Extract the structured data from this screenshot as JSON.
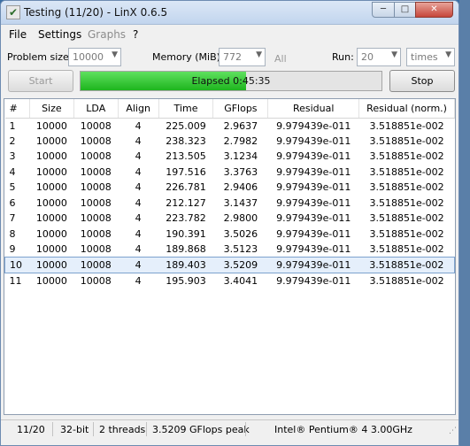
{
  "window": {
    "title": "Testing (11/20) - LinX 0.6.5",
    "minimize": "─",
    "maximize": "□",
    "close": "✕"
  },
  "menu": [
    "File",
    "Settings",
    "Graphs",
    "?"
  ],
  "controls": {
    "problem_size_label": "Problem size:",
    "problem_size_value": "10000",
    "memory_label": "Memory (MiB):",
    "memory_value": "772",
    "all_label": "All",
    "run_label": "Run:",
    "run_value": "20",
    "run_unit": "times",
    "start_label": "Start",
    "stop_label": "Stop"
  },
  "progress": {
    "text": "Elapsed 0:45:35",
    "fraction": 0.55
  },
  "table": {
    "columns": [
      "#",
      "Size",
      "LDA",
      "Align",
      "Time",
      "GFlops",
      "Residual",
      "Residual (norm.)"
    ],
    "rows": [
      [
        "1",
        "10000",
        "10008",
        "4",
        "225.009",
        "2.9637",
        "9.979439e-011",
        "3.518851e-002"
      ],
      [
        "2",
        "10000",
        "10008",
        "4",
        "238.323",
        "2.7982",
        "9.979439e-011",
        "3.518851e-002"
      ],
      [
        "3",
        "10000",
        "10008",
        "4",
        "213.505",
        "3.1234",
        "9.979439e-011",
        "3.518851e-002"
      ],
      [
        "4",
        "10000",
        "10008",
        "4",
        "197.516",
        "3.3763",
        "9.979439e-011",
        "3.518851e-002"
      ],
      [
        "5",
        "10000",
        "10008",
        "4",
        "226.781",
        "2.9406",
        "9.979439e-011",
        "3.518851e-002"
      ],
      [
        "6",
        "10000",
        "10008",
        "4",
        "212.127",
        "3.1437",
        "9.979439e-011",
        "3.518851e-002"
      ],
      [
        "7",
        "10000",
        "10008",
        "4",
        "223.782",
        "2.9800",
        "9.979439e-011",
        "3.518851e-002"
      ],
      [
        "8",
        "10000",
        "10008",
        "4",
        "190.391",
        "3.5026",
        "9.979439e-011",
        "3.518851e-002"
      ],
      [
        "9",
        "10000",
        "10008",
        "4",
        "189.868",
        "3.5123",
        "9.979439e-011",
        "3.518851e-002"
      ],
      [
        "10",
        "10000",
        "10008",
        "4",
        "189.403",
        "3.5209",
        "9.979439e-011",
        "3.518851e-002"
      ],
      [
        "11",
        "10000",
        "10008",
        "4",
        "195.903",
        "3.4041",
        "9.979439e-011",
        "3.518851e-002"
      ]
    ],
    "selected_row": 10
  },
  "status": {
    "progress": "11/20",
    "bits": "32-bit",
    "threads": "2 threads",
    "peak": "3.5209 GFlops peak",
    "cpu": "Intel® Pentium® 4 3.00GHz"
  },
  "colors": {
    "progress_fill": "#22b822",
    "selection": "#e5effb"
  }
}
